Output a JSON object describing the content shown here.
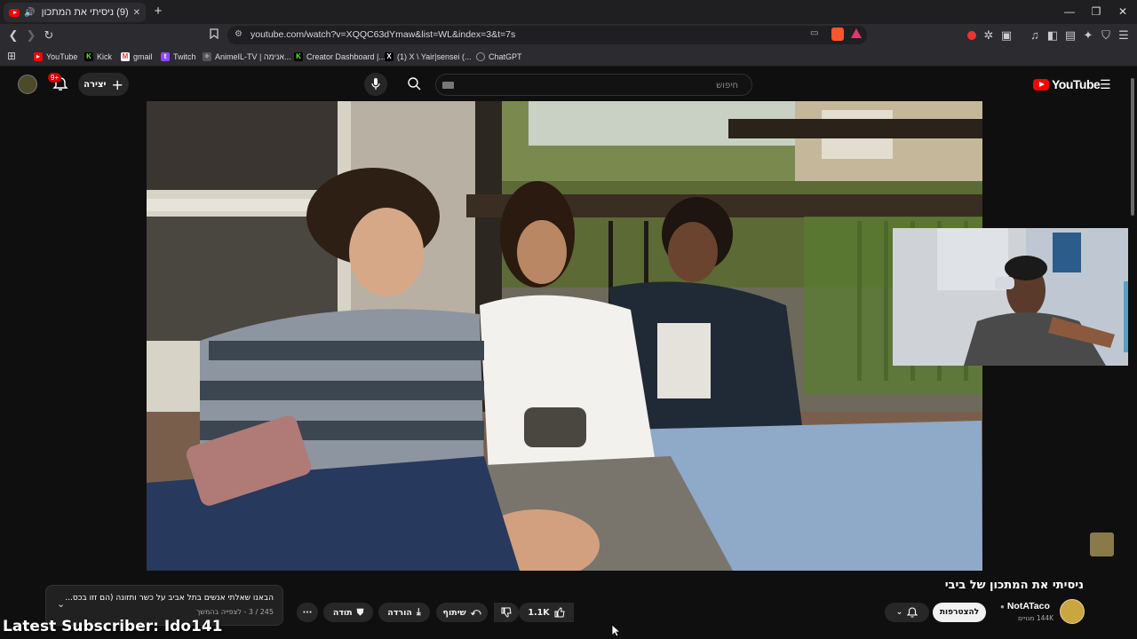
{
  "browser": {
    "tab_title": "(9) ניסיתי את המתכון של ביבי",
    "new_tab": "+",
    "url": "youtube.com/watch?v=XQQC63dYmaw&list=WL&index=3&t=7s",
    "window_controls": {
      "minimize": "—",
      "restore": "❐",
      "close": "✕"
    }
  },
  "bookmarks": [
    {
      "label": "YouTube",
      "icon": "youtube-icon",
      "color": "#ff0000"
    },
    {
      "label": "Kick",
      "icon": "kick-icon",
      "color": "#53fc18"
    },
    {
      "label": "gmail",
      "icon": "gmail-icon",
      "color": "#ea4335"
    },
    {
      "label": "Twitch",
      "icon": "twitch-icon",
      "color": "#9146ff"
    },
    {
      "label": "AnimeIL-TV | אנימה...",
      "icon": "animeil-icon",
      "color": "#888888"
    },
    {
      "label": "Creator Dashboard |...",
      "icon": "kick-icon",
      "color": "#53fc18"
    },
    {
      "label": "(1) X \\ Yair|sensei (...",
      "icon": "x-icon",
      "color": "#000000"
    },
    {
      "label": "ChatGPT",
      "icon": "chatgpt-icon",
      "color": "#cccccc"
    }
  ],
  "yt_header": {
    "logo": "YouTube",
    "search_placeholder": "חיפוש",
    "create_label": "יצירה",
    "notif_count": "9+"
  },
  "video": {
    "title": "ניסיתי את המתכון של ביבי",
    "channel": "NotATaco",
    "subscribers": "144K מנויים",
    "subscribe_label": "להצטרפות",
    "likes": "1.1K",
    "share_label": "שיתוף",
    "download_label": "הורדה",
    "thanks_label": "תודה",
    "more_label": "···"
  },
  "playlist": {
    "title": "הבאנו שאלתי אנשים בתל אביב על כשר ותזונה (הם זזו בכס...",
    "position": "245 / 3 - לצפייה בהמשך"
  },
  "overlay": {
    "latest_subscriber": "Latest Subscriber: Ido141"
  },
  "colors": {
    "youtube_red": "#ff0000",
    "page_bg": "#0f0f0f",
    "pill_bg": "#272727"
  }
}
